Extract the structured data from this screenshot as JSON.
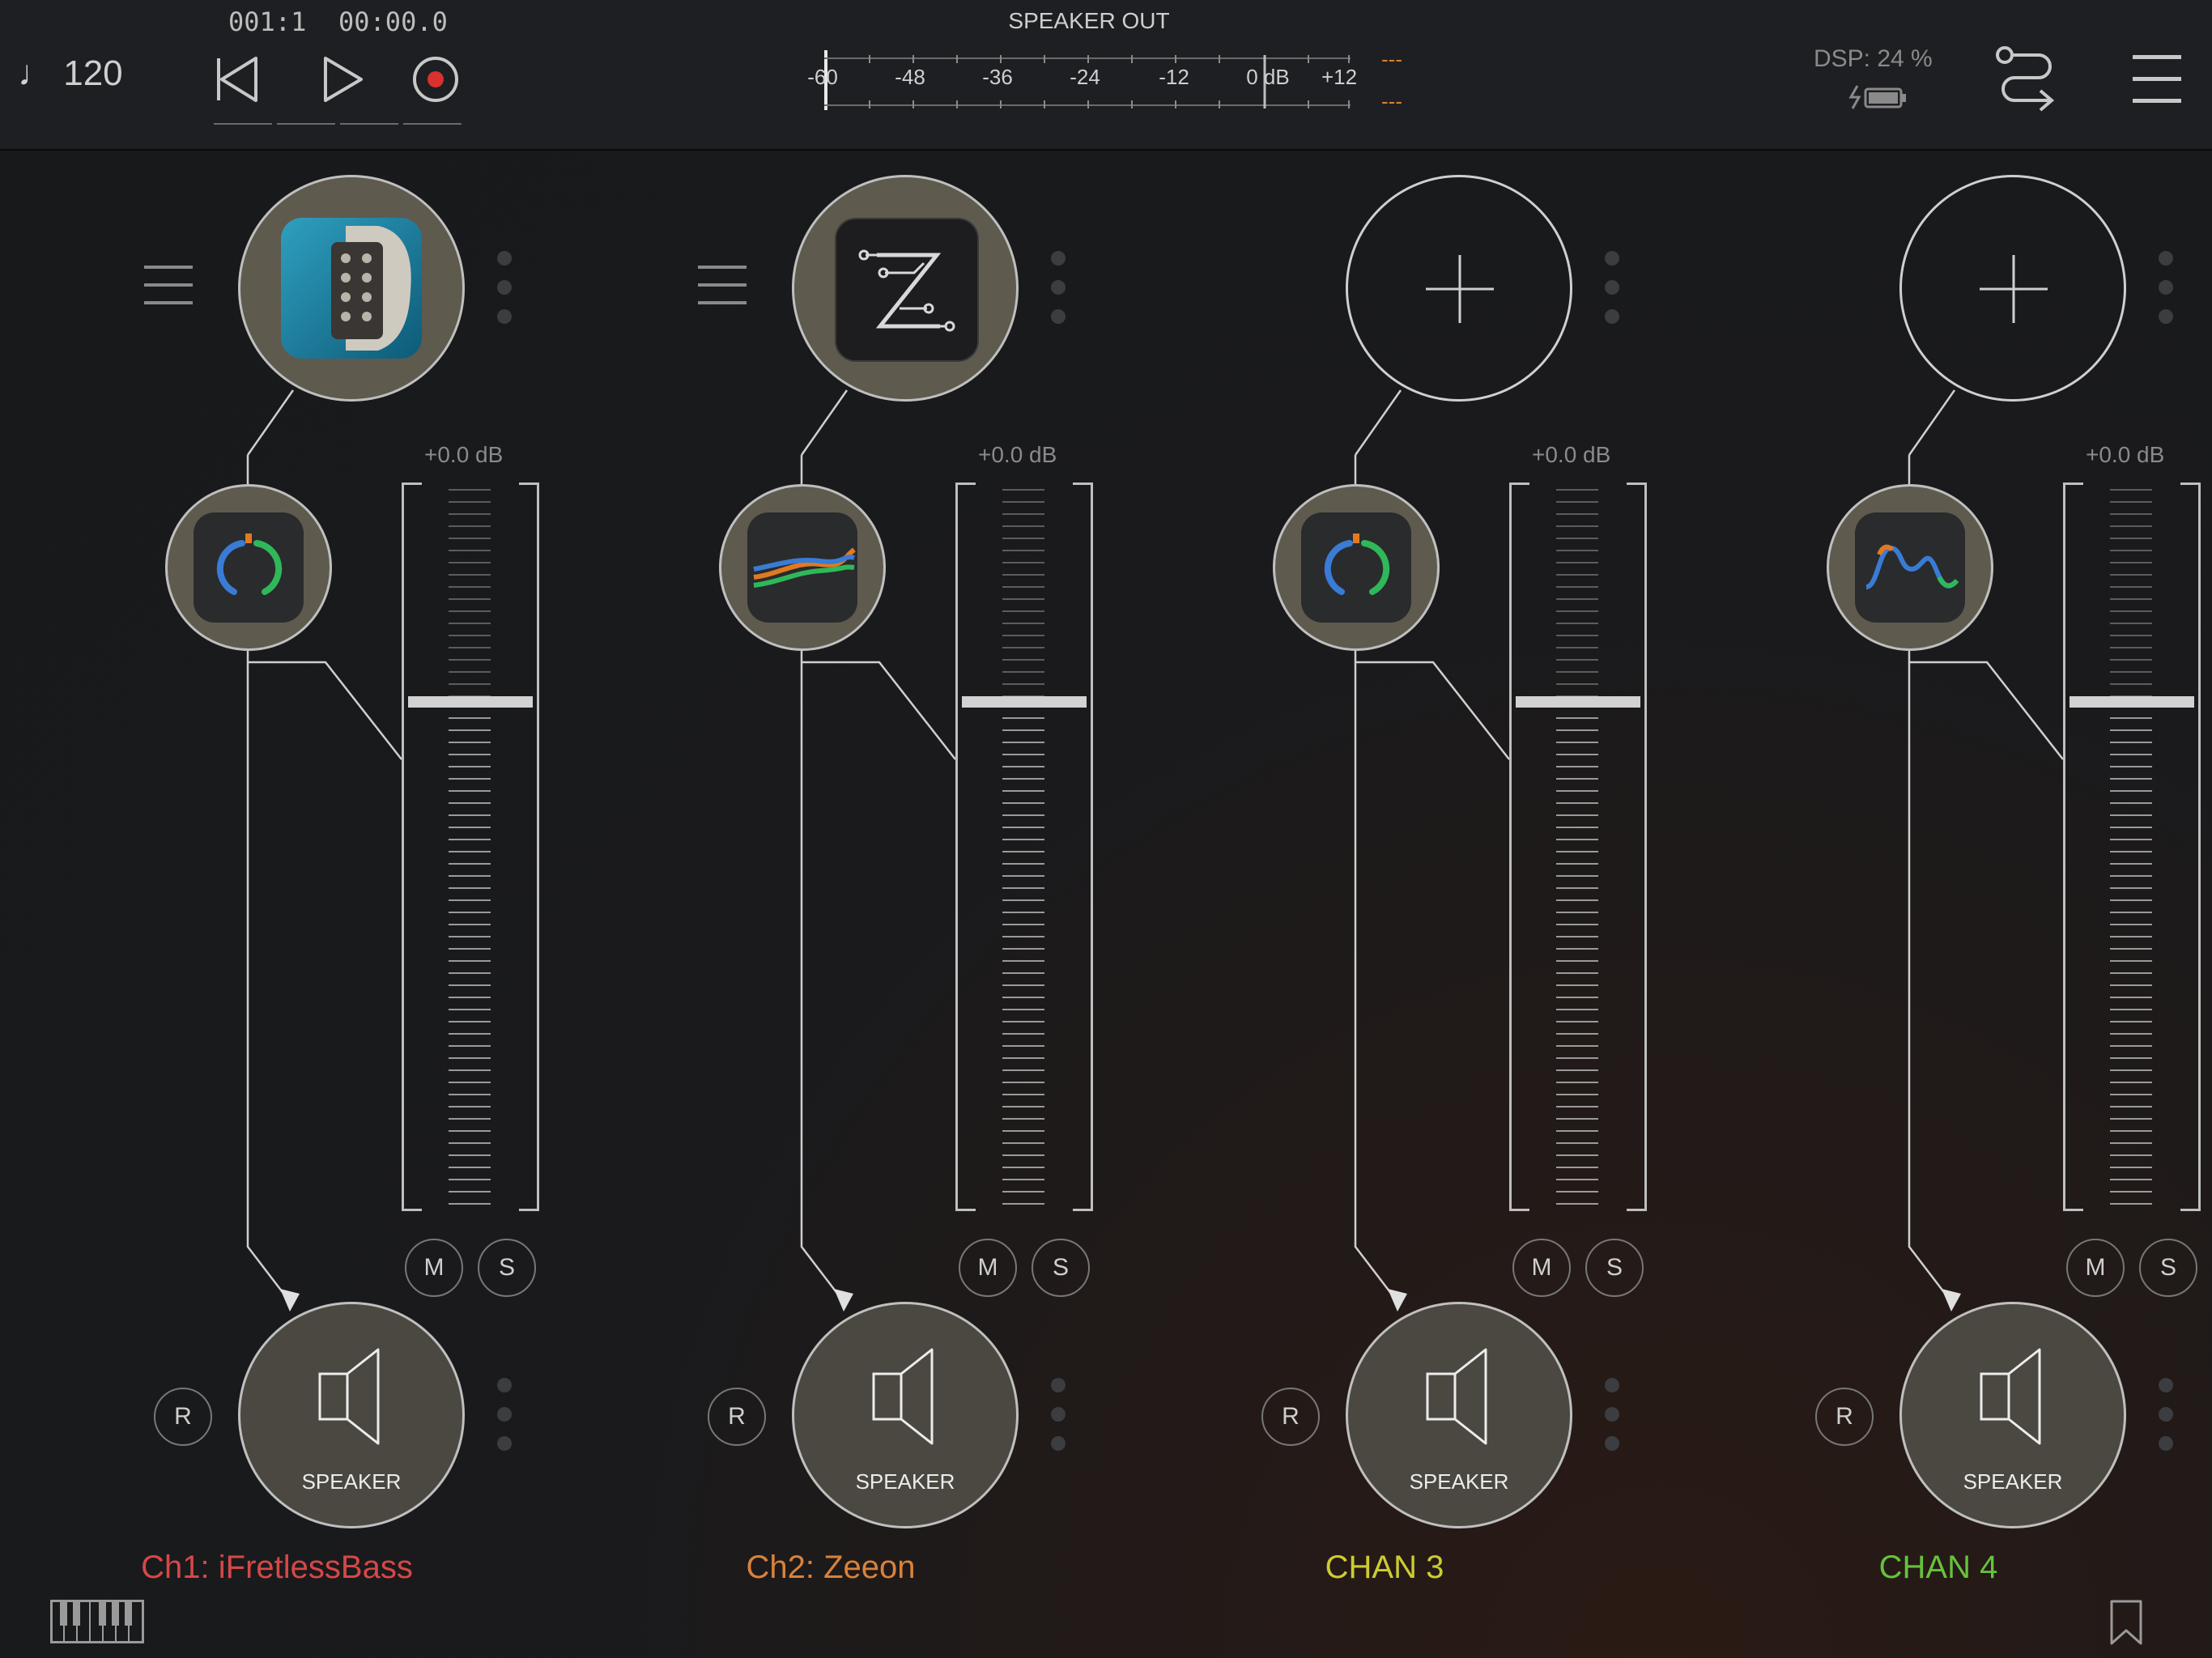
{
  "transport": {
    "tempo": "♩ 120",
    "bar_beat": "001:1",
    "time": "00:00.0"
  },
  "meter": {
    "title": "SPEAKER OUT",
    "ticks": [
      "-60",
      "-48",
      "-36",
      "-24",
      "-12",
      "0 dB",
      "+12"
    ],
    "peak_left": "---",
    "peak_right": "---"
  },
  "dsp": {
    "label": "DSP: 24 %"
  },
  "colors": {
    "ch1": "#d64848",
    "ch2": "#d9823b",
    "ch3": "#cccc33",
    "ch4": "#66c23c",
    "accent_red": "#d93030"
  },
  "channels": [
    {
      "name": "Ch1: iFretlessBass",
      "instrument_icon": "ifretlessbass-app-icon",
      "effect_icon": "knob-effect-icon",
      "gain": "+0.0 dB",
      "mute": "M",
      "solo": "S",
      "record": "R",
      "output": "SPEAKER"
    },
    {
      "name": "Ch2: Zeeon",
      "instrument_icon": "zeeon-app-icon",
      "effect_icon": "filter-curve-effect-icon",
      "gain": "+0.0 dB",
      "mute": "M",
      "solo": "S",
      "record": "R",
      "output": "SPEAKER"
    },
    {
      "name": "CHAN 3",
      "instrument_icon": "add-plus-icon",
      "effect_icon": "knob-effect-icon",
      "gain": "+0.0 dB",
      "mute": "M",
      "solo": "S",
      "record": "R",
      "output": "SPEAKER"
    },
    {
      "name": "CHAN 4",
      "instrument_icon": "add-plus-icon",
      "effect_icon": "eq-curve-effect-icon",
      "gain": "+0.0 dB",
      "mute": "M",
      "solo": "S",
      "record": "R",
      "output": "SPEAKER"
    }
  ]
}
